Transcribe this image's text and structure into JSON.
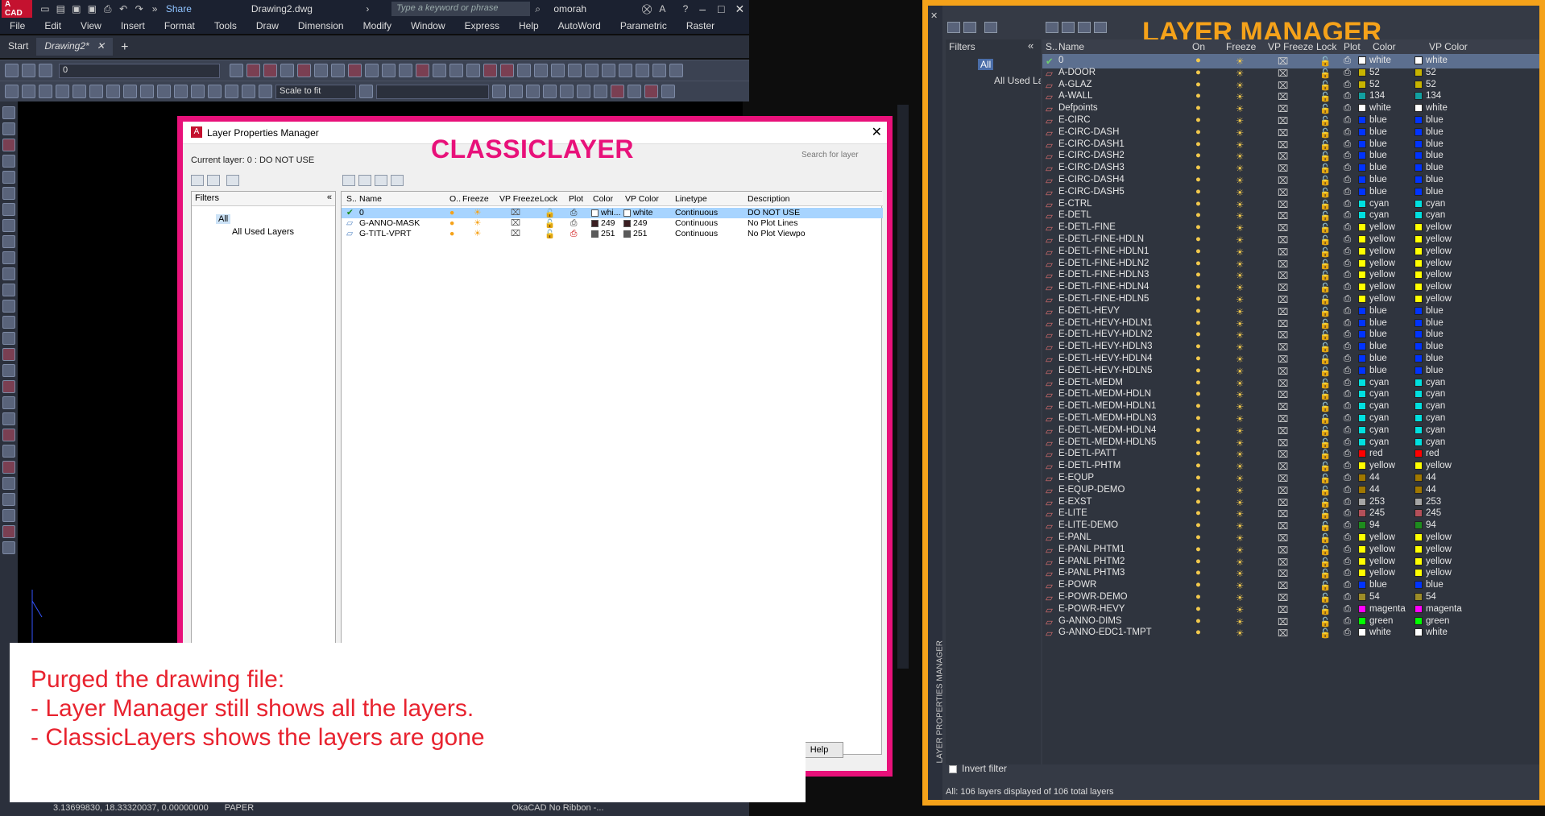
{
  "titlebar": {
    "logo": "A CAD",
    "share": "Share",
    "filename": "Drawing2.dwg",
    "search_placeholder": "Type a keyword or phrase",
    "user": "omorah"
  },
  "menu": [
    "File",
    "Edit",
    "View",
    "Insert",
    "Format",
    "Tools",
    "Draw",
    "Dimension",
    "Modify",
    "Window",
    "Express",
    "Help",
    "AutoWord",
    "Parametric",
    "Raster"
  ],
  "tabs": {
    "start": "Start",
    "drawing": "Drawing2*"
  },
  "toolbar": {
    "layer_combo": "0",
    "scale_combo": "Scale to fit"
  },
  "classic": {
    "label": "CLASSICLAYER",
    "title": "Layer Properties Manager",
    "current": "Current layer: 0 : DO NOT USE",
    "search_placeholder": "Search for layer",
    "filters_header": "Filters",
    "tree_all": "All",
    "tree_used": "All Used Layers",
    "headers": [
      "S..",
      "Name",
      "O..",
      "Freeze",
      "VP Freeze",
      "Lock",
      "Plot",
      "Color",
      "VP Color",
      "Linetype",
      "Description"
    ],
    "rows": [
      {
        "name": "0",
        "color": "whi...",
        "color_hex": "#ffffff",
        "vpcolor": "white",
        "vp_hex": "#ffffff",
        "linetype": "Continuous",
        "desc": "DO NOT USE"
      },
      {
        "name": "G-ANNO-MASK",
        "color": "249",
        "color_hex": "#3b1f22",
        "vpcolor": "249",
        "vp_hex": "#3b1f22",
        "linetype": "Continuous",
        "desc": "No Plot Lines"
      },
      {
        "name": "G-TITL-VPRT",
        "color": "251",
        "color_hex": "#5a5a5a",
        "vpcolor": "251",
        "vp_hex": "#5a5a5a",
        "linetype": "Continuous",
        "desc": "No Plot Viewpo"
      }
    ],
    "help": "Help"
  },
  "note": {
    "line1": "Purged the drawing file:",
    "line2": "- Layer Manager still shows all the layers.",
    "line3": "- ClassicLayers shows the layers are gone"
  },
  "statusbar": {
    "coords": "3.13699830, 18.33320037, 0.00000000",
    "mode": "PAPER",
    "profile": "OkaCAD No Ribbon -..."
  },
  "lm": {
    "label": "LAYER MANAGER",
    "side_title": "LAYER PROPERTIES MANAGER",
    "filters_header": "Filters",
    "tree_all": "All",
    "tree_used": "All Used Layers",
    "invert": "Invert filter",
    "status": "All: 106 layers displayed of 106 total layers",
    "headers": [
      "S..",
      "Name",
      "On",
      "Freeze",
      "VP Freeze",
      "Lock",
      "Plot",
      "Color",
      "VP Color"
    ],
    "rows": [
      {
        "n": "0",
        "c": "white",
        "h": "#ffffff"
      },
      {
        "n": "A-DOOR",
        "c": "52",
        "h": "#c8b400"
      },
      {
        "n": "A-GLAZ",
        "c": "52",
        "h": "#c8b400"
      },
      {
        "n": "A-WALL",
        "c": "134",
        "h": "#12a0a0"
      },
      {
        "n": "Defpoints",
        "c": "white",
        "h": "#ffffff"
      },
      {
        "n": "E-CIRC",
        "c": "blue",
        "h": "#0033ff"
      },
      {
        "n": "E-CIRC-DASH",
        "c": "blue",
        "h": "#0033ff"
      },
      {
        "n": "E-CIRC-DASH1",
        "c": "blue",
        "h": "#0033ff"
      },
      {
        "n": "E-CIRC-DASH2",
        "c": "blue",
        "h": "#0033ff"
      },
      {
        "n": "E-CIRC-DASH3",
        "c": "blue",
        "h": "#0033ff"
      },
      {
        "n": "E-CIRC-DASH4",
        "c": "blue",
        "h": "#0033ff"
      },
      {
        "n": "E-CIRC-DASH5",
        "c": "blue",
        "h": "#0033ff"
      },
      {
        "n": "E-CTRL",
        "c": "cyan",
        "h": "#00e0e0"
      },
      {
        "n": "E-DETL",
        "c": "cyan",
        "h": "#00e0e0"
      },
      {
        "n": "E-DETL-FINE",
        "c": "yellow",
        "h": "#ffff00"
      },
      {
        "n": "E-DETL-FINE-HDLN",
        "c": "yellow",
        "h": "#ffff00"
      },
      {
        "n": "E-DETL-FINE-HDLN1",
        "c": "yellow",
        "h": "#ffff00"
      },
      {
        "n": "E-DETL-FINE-HDLN2",
        "c": "yellow",
        "h": "#ffff00"
      },
      {
        "n": "E-DETL-FINE-HDLN3",
        "c": "yellow",
        "h": "#ffff00"
      },
      {
        "n": "E-DETL-FINE-HDLN4",
        "c": "yellow",
        "h": "#ffff00"
      },
      {
        "n": "E-DETL-FINE-HDLN5",
        "c": "yellow",
        "h": "#ffff00"
      },
      {
        "n": "E-DETL-HEVY",
        "c": "blue",
        "h": "#0033ff"
      },
      {
        "n": "E-DETL-HEVY-HDLN1",
        "c": "blue",
        "h": "#0033ff"
      },
      {
        "n": "E-DETL-HEVY-HDLN2",
        "c": "blue",
        "h": "#0033ff"
      },
      {
        "n": "E-DETL-HEVY-HDLN3",
        "c": "blue",
        "h": "#0033ff"
      },
      {
        "n": "E-DETL-HEVY-HDLN4",
        "c": "blue",
        "h": "#0033ff"
      },
      {
        "n": "E-DETL-HEVY-HDLN5",
        "c": "blue",
        "h": "#0033ff"
      },
      {
        "n": "E-DETL-MEDM",
        "c": "cyan",
        "h": "#00e0e0"
      },
      {
        "n": "E-DETL-MEDM-HDLN",
        "c": "cyan",
        "h": "#00e0e0"
      },
      {
        "n": "E-DETL-MEDM-HDLN1",
        "c": "cyan",
        "h": "#00e0e0"
      },
      {
        "n": "E-DETL-MEDM-HDLN3",
        "c": "cyan",
        "h": "#00e0e0"
      },
      {
        "n": "E-DETL-MEDM-HDLN4",
        "c": "cyan",
        "h": "#00e0e0"
      },
      {
        "n": "E-DETL-MEDM-HDLN5",
        "c": "cyan",
        "h": "#00e0e0"
      },
      {
        "n": "E-DETL-PATT",
        "c": "red",
        "h": "#ff0000"
      },
      {
        "n": "E-DETL-PHTM",
        "c": "yellow",
        "h": "#ffff00"
      },
      {
        "n": "E-EQUP",
        "c": "44",
        "h": "#a07800"
      },
      {
        "n": "E-EQUP-DEMO",
        "c": "44",
        "h": "#a07800"
      },
      {
        "n": "E-EXST",
        "c": "253",
        "h": "#a5a5a5"
      },
      {
        "n": "E-LITE",
        "c": "245",
        "h": "#b4505a"
      },
      {
        "n": "E-LITE-DEMO",
        "c": "94",
        "h": "#1e8c1e"
      },
      {
        "n": "E-PANL",
        "c": "yellow",
        "h": "#ffff00"
      },
      {
        "n": "E-PANL PHTM1",
        "c": "yellow",
        "h": "#ffff00"
      },
      {
        "n": "E-PANL PHTM2",
        "c": "yellow",
        "h": "#ffff00"
      },
      {
        "n": "E-PANL PHTM3",
        "c": "yellow",
        "h": "#ffff00"
      },
      {
        "n": "E-POWR",
        "c": "blue",
        "h": "#0033ff"
      },
      {
        "n": "E-POWR-DEMO",
        "c": "54",
        "h": "#9c8c28"
      },
      {
        "n": "E-POWR-HEVY",
        "c": "magenta",
        "h": "#ff00ff"
      },
      {
        "n": "G-ANNO-DIMS",
        "c": "green",
        "h": "#00ff00"
      },
      {
        "n": "G-ANNO-EDC1-TMPT",
        "c": "white",
        "h": "#ffffff"
      }
    ]
  }
}
